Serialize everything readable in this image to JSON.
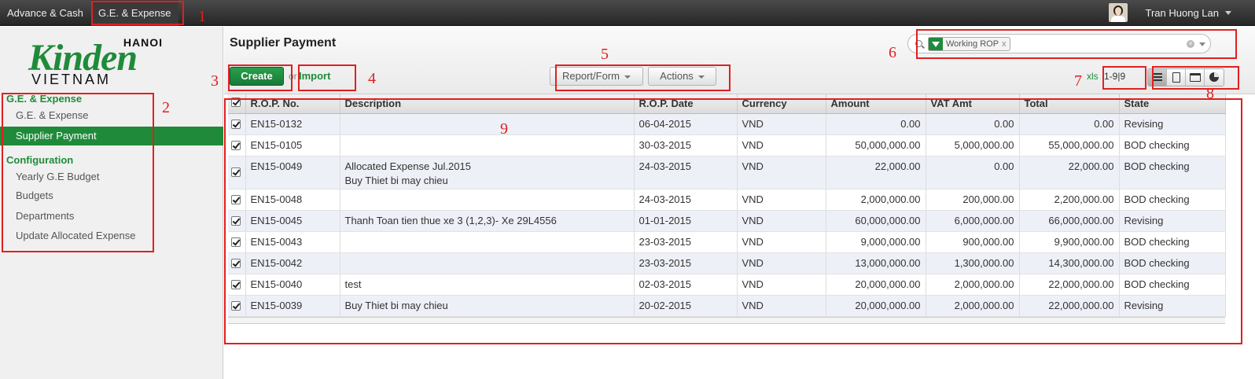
{
  "topbar": {
    "menu": [
      "Advance & Cash",
      "G.E. & Expense"
    ],
    "user_name": "Tran Huong Lan"
  },
  "logo": {
    "line1": "HANOI",
    "line2": "Kinden",
    "line3": "VIETNAM"
  },
  "sidebar": {
    "sections": [
      {
        "title": "G.E. & Expense",
        "items": [
          "G.E. & Expense",
          "Supplier Payment"
        ]
      },
      {
        "title": "Configuration",
        "items": [
          "Yearly G.E Budget",
          "Budgets",
          "Departments",
          "Update Allocated Expense"
        ]
      }
    ],
    "active_item": "Supplier Payment"
  },
  "header": {
    "title": "Supplier Payment",
    "create_label": "Create",
    "or_label": "or",
    "import_label": "Import",
    "report_label": "Report/Form",
    "actions_label": "Actions",
    "search_facet": "Working ROP",
    "facet_remove": "x",
    "xls_label": "xls",
    "pager": "1-9|9"
  },
  "table": {
    "columns": [
      "R.O.P. No.",
      "Description",
      "R.O.P. Date",
      "Currency",
      "Amount",
      "VAT Amt",
      "Total",
      "State"
    ],
    "rows": [
      {
        "no": "EN15-0132",
        "desc": "",
        "desc2": "",
        "date": "06-04-2015",
        "cur": "VND",
        "amount": "0.00",
        "vat": "0.00",
        "total": "0.00",
        "state": "Revising"
      },
      {
        "no": "EN15-0105",
        "desc": "",
        "desc2": "",
        "date": "30-03-2015",
        "cur": "VND",
        "amount": "50,000,000.00",
        "vat": "5,000,000.00",
        "total": "55,000,000.00",
        "state": "BOD checking"
      },
      {
        "no": "EN15-0049",
        "desc": "Allocated Expense Jul.2015",
        "desc2": "Buy Thiet bi may chieu",
        "date": "24-03-2015",
        "cur": "VND",
        "amount": "22,000.00",
        "vat": "0.00",
        "total": "22,000.00",
        "state": "BOD checking"
      },
      {
        "no": "EN15-0048",
        "desc": "",
        "desc2": "",
        "date": "24-03-2015",
        "cur": "VND",
        "amount": "2,000,000.00",
        "vat": "200,000.00",
        "total": "2,200,000.00",
        "state": "BOD checking"
      },
      {
        "no": "EN15-0045",
        "desc": "Thanh Toan tien thue xe 3 (1,2,3)- Xe 29L4556",
        "desc2": "",
        "date": "01-01-2015",
        "cur": "VND",
        "amount": "60,000,000.00",
        "vat": "6,000,000.00",
        "total": "66,000,000.00",
        "state": "Revising"
      },
      {
        "no": "EN15-0043",
        "desc": "",
        "desc2": "",
        "date": "23-03-2015",
        "cur": "VND",
        "amount": "9,000,000.00",
        "vat": "900,000.00",
        "total": "9,900,000.00",
        "state": "BOD checking"
      },
      {
        "no": "EN15-0042",
        "desc": "",
        "desc2": "",
        "date": "23-03-2015",
        "cur": "VND",
        "amount": "13,000,000.00",
        "vat": "1,300,000.00",
        "total": "14,300,000.00",
        "state": "BOD checking"
      },
      {
        "no": "EN15-0040",
        "desc": "test",
        "desc2": "",
        "date": "02-03-2015",
        "cur": "VND",
        "amount": "20,000,000.00",
        "vat": "2,000,000.00",
        "total": "22,000,000.00",
        "state": "BOD checking"
      },
      {
        "no": "EN15-0039",
        "desc": "Buy Thiet bi may chieu",
        "desc2": "",
        "date": "20-02-2015",
        "cur": "VND",
        "amount": "20,000,000.00",
        "vat": "2,000,000.00",
        "total": "22,000,000.00",
        "state": "Revising"
      }
    ]
  },
  "annotations": [
    "1",
    "2",
    "3",
    "4",
    "5",
    "6",
    "7",
    "8",
    "9"
  ],
  "colors": {
    "accent": "#1f8b3a",
    "annotation": "#e02020",
    "topbar": "#2e2e2e",
    "row_alt": "#eef0f7"
  }
}
